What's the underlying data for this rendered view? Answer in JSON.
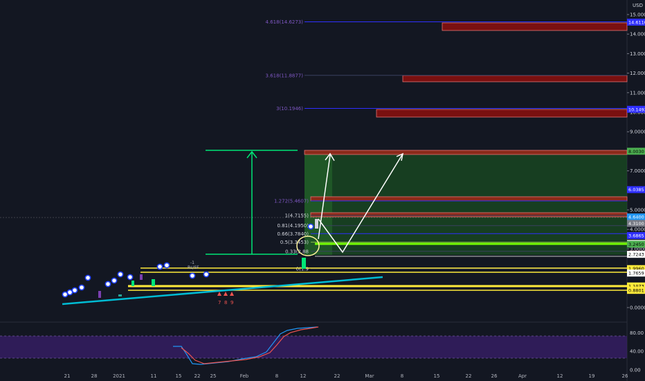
{
  "chart_data": {
    "type": "candlestick",
    "currency": "USD",
    "price_axis": {
      "ticks": [
        "15.0000",
        "14.0000",
        "13.0000",
        "12.0000",
        "11.0000",
        "10.0000",
        "9.0000",
        "8.0000",
        "7.0000",
        "6.0000",
        "5.0000",
        "4.0000",
        "3.0000",
        "2.0000",
        "1.0000",
        "0.0000"
      ],
      "tick_values": [
        15,
        14,
        13,
        12,
        11,
        10,
        9,
        8,
        7,
        6,
        5,
        4,
        3,
        2,
        1,
        0
      ]
    },
    "time_axis": {
      "labels": [
        "21",
        "28",
        "2021",
        "11",
        "15",
        "22",
        "25",
        "Feb",
        "8",
        "12",
        "22",
        "Mar",
        "8",
        "15",
        "22",
        "26",
        "Apr",
        "12",
        "19",
        "26"
      ]
    },
    "fib_levels": [
      {
        "label": "4.618(14.6273)",
        "value": 14.6273,
        "color": "#2f2fff"
      },
      {
        "label": "3.618(11.8877)",
        "value": 11.8877,
        "color": "#3a4060"
      },
      {
        "label": "3(10.1946)",
        "value": 10.1946,
        "color": "#2f2fff"
      },
      {
        "label": "1.272(5.4607)",
        "value": 5.4607,
        "color": "#2f2fff"
      },
      {
        "label": "1(4.7155)",
        "value": 4.7155,
        "color": "#3a4060"
      },
      {
        "label": "0.81(4.1950)",
        "value": 4.195,
        "color": "#3a4060"
      },
      {
        "label": "0.66(3.7840)",
        "value": 3.784,
        "color": "#2f2fff"
      },
      {
        "label": "0.5(3.3453)",
        "value": 3.3453,
        "color": "#8bc34a"
      },
      {
        "label": "0.33(2.88",
        "value": 2.88,
        "color": "#3a4060"
      },
      {
        "label": "0(1.9",
        "value": 1.99,
        "color": "#3a4060"
      }
    ],
    "price_badges": [
      {
        "text": "14.6110",
        "value": 14.611,
        "bg": "#2f2fff",
        "fg": "#ffffff"
      },
      {
        "text": "10.1492",
        "value": 10.1492,
        "bg": "#2f2fff",
        "fg": "#ffffff"
      },
      {
        "text": "8.0030",
        "value": 8.003,
        "bg": "#4caf50",
        "fg": "#000000"
      },
      {
        "text": "6.0385",
        "value": 6.0385,
        "bg": "#2f2fff",
        "fg": "#ffffff"
      },
      {
        "text": "4.6400",
        "value": 4.64,
        "bg": "#2196f3",
        "fg": "#ffffff"
      },
      {
        "text": "4.3100",
        "value": 4.31,
        "bg": "#787b86",
        "fg": "#ffffff"
      },
      {
        "text": "3.6865",
        "value": 3.6865,
        "bg": "#2f2fff",
        "fg": "#ffffff"
      },
      {
        "text": "3.2856",
        "value": 3.2856,
        "bg": "#ffffff",
        "fg": "#000000"
      },
      {
        "text": "3.2450",
        "value": 3.245,
        "bg": "#4caf50",
        "fg": "#000000"
      },
      {
        "text": "2.7325",
        "value": 2.7325,
        "bg": "#d32f2f",
        "fg": "#ffffff"
      },
      {
        "text": "2.7243",
        "value": 2.7243,
        "bg": "#ffffff",
        "fg": "#000000"
      },
      {
        "text": "1.9960",
        "value": 1.996,
        "bg": "#ffeb3b",
        "fg": "#000000"
      },
      {
        "text": "1.7659",
        "value": 1.7659,
        "bg": "#ffffff",
        "fg": "#000000"
      },
      {
        "text": "1.1073",
        "value": 1.1073,
        "bg": "#ffeb3b",
        "fg": "#000000"
      },
      {
        "text": "0.8801",
        "value": 0.8801,
        "bg": "#ffeb3b",
        "fg": "#000000"
      }
    ],
    "annotations": [
      "7",
      "8",
      "9",
      "-1",
      "Rs/SF",
      "Open"
    ],
    "indicator": {
      "ticks": [
        "80.00",
        "40.00",
        "0.00"
      ],
      "tick_values": [
        80,
        40,
        0
      ],
      "band": [
        20,
        80
      ]
    },
    "colors": {
      "background": "#131722",
      "up": "#26a69a",
      "down": "#ef5350",
      "trendline": "#00bcd4",
      "measure": "#00e676",
      "projection": "#ffffff",
      "support": "#ffeb3b",
      "target_zone": "#1b5e20",
      "resistance_zone": "#8b1a1a"
    }
  }
}
